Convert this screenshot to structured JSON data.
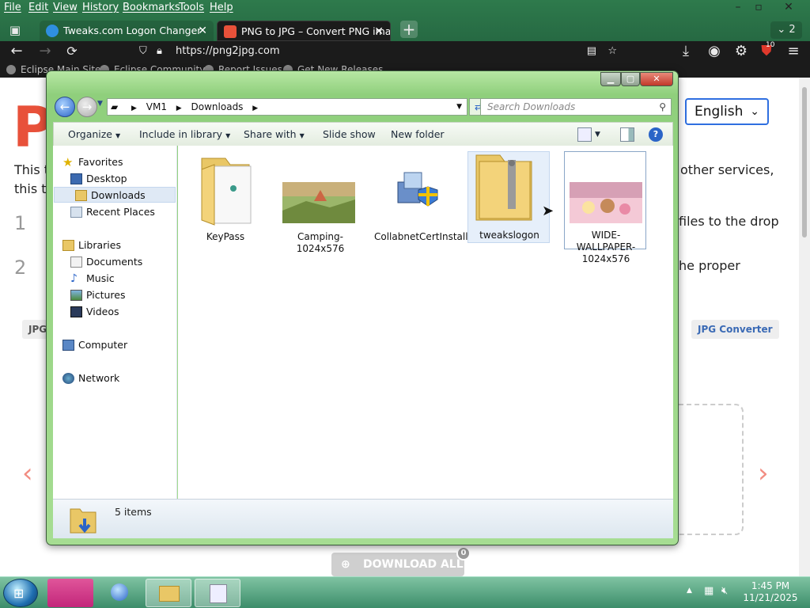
{
  "firefox": {
    "menu": [
      "File",
      "Edit",
      "View",
      "History",
      "Bookmarks",
      "Tools",
      "Help"
    ],
    "tabs": [
      {
        "title": "Tweaks.com Logon Changer",
        "active": false
      },
      {
        "title": "PNG to JPG – Convert PNG imag",
        "active": true
      }
    ],
    "tab_count": "2",
    "url": "https://png2jpg.com",
    "bookmarks": [
      "Eclipse Main Site",
      "Eclipse Community",
      "Report Issues",
      "Get New Releases"
    ],
    "extension_badge": "10"
  },
  "page": {
    "title_letter": "P",
    "lang_select": "English",
    "intro_left": "This t",
    "intro_left2": "this t",
    "intro_right": "other services,",
    "step1_num": "1",
    "step2_num": "2",
    "step1_tail": "files to the drop",
    "step2_tail": "he proper",
    "pill_left": "JPG",
    "pill_right": "JPG Converter",
    "download_all": "DOWNLOAD ALL",
    "download_count": "0"
  },
  "explorer": {
    "breadcrumb": [
      "VM1",
      "Downloads"
    ],
    "search_placeholder": "Search Downloads",
    "toolbar": {
      "organize": "Organize",
      "include": "Include in library",
      "share": "Share with",
      "slideshow": "Slide show",
      "newfolder": "New folder"
    },
    "nav": {
      "favorites_label": "Favorites",
      "favorites": [
        "Desktop",
        "Downloads",
        "Recent Places"
      ],
      "libraries_label": "Libraries",
      "libraries": [
        "Documents",
        "Music",
        "Pictures",
        "Videos"
      ],
      "computer": "Computer",
      "network": "Network"
    },
    "selected_nav": "Downloads",
    "files": [
      {
        "name": "KeyPass",
        "kind": "folder"
      },
      {
        "name": "Camping-1024x576",
        "kind": "image"
      },
      {
        "name": "CollabnetCertInstaller",
        "kind": "installer"
      },
      {
        "name": "tweakslogon",
        "kind": "zip"
      },
      {
        "name": "WIDE-WALLPAPER-1024x576",
        "kind": "image"
      }
    ],
    "status": "5 items"
  },
  "taskbar": {
    "time": "1:45 PM",
    "date": "11/21/2025"
  },
  "colors": {
    "accent": "#2a64c7",
    "firefox_bar": "#1b1b1b",
    "explorer_frame": "#a6dd92"
  }
}
